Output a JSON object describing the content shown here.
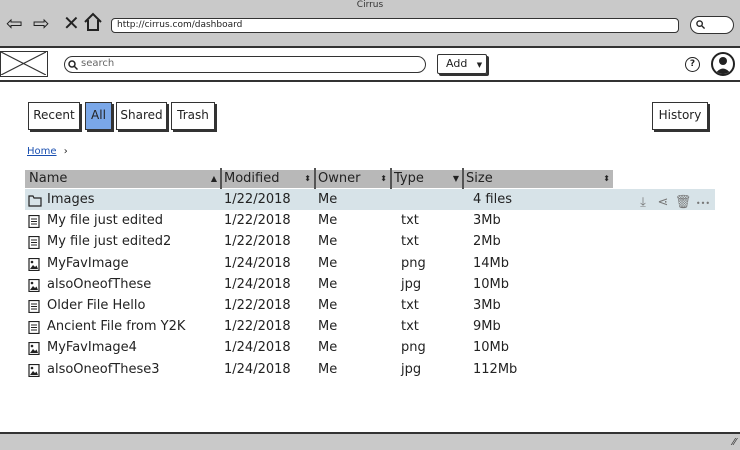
{
  "window": {
    "title": "Cirrus"
  },
  "browser": {
    "back_icon": "arrow-left-icon",
    "forward_icon": "arrow-right-icon",
    "stop_icon": "close-icon",
    "home_icon": "home-icon",
    "url": "http://cirrus.com/dashboard",
    "search_icon": "search-icon"
  },
  "appbar": {
    "search_placeholder": "search",
    "add_label": "Add",
    "help_icon": "help-icon",
    "avatar_icon": "user-avatar-icon"
  },
  "tabs": [
    {
      "label": "Recent",
      "active": false
    },
    {
      "label": "All",
      "active": true
    },
    {
      "label": "Shared",
      "active": false
    },
    {
      "label": "Trash",
      "active": false
    }
  ],
  "history_label": "History",
  "breadcrumb": {
    "home": "Home"
  },
  "table": {
    "columns": [
      "Name",
      "Modified",
      "Owner",
      "Type",
      "Size"
    ],
    "rows": [
      {
        "name": "Images",
        "modified": "1/22/2018",
        "owner": "Me",
        "type": "",
        "size": "4 files",
        "icon": "folder-icon",
        "selected": true
      },
      {
        "name": "My file just edited",
        "modified": "1/22/2018",
        "owner": "Me",
        "type": "txt",
        "size": "3Mb",
        "icon": "document-icon"
      },
      {
        "name": "My file just edited2",
        "modified": "1/22/2018",
        "owner": "Me",
        "type": "txt",
        "size": "2Mb",
        "icon": "document-icon"
      },
      {
        "name": "MyFavImage",
        "modified": "1/24/2018",
        "owner": "Me",
        "type": "png",
        "size": "14Mb",
        "icon": "image-file-icon"
      },
      {
        "name": "alsoOneofThese",
        "modified": "1/24/2018",
        "owner": "Me",
        "type": "jpg",
        "size": "10Mb",
        "icon": "image-file-icon"
      },
      {
        "name": "Older File Hello",
        "modified": "1/22/2018",
        "owner": "Me",
        "type": "txt",
        "size": "3Mb",
        "icon": "document-icon"
      },
      {
        "name": "Ancient File from Y2K",
        "modified": "1/22/2018",
        "owner": "Me",
        "type": "txt",
        "size": "9Mb",
        "icon": "document-icon"
      },
      {
        "name": "MyFavImage4",
        "modified": "1/24/2018",
        "owner": "Me",
        "type": "png",
        "size": "10Mb",
        "icon": "image-file-icon"
      },
      {
        "name": "alsoOneofThese3",
        "modified": "1/24/2018",
        "owner": "Me",
        "type": "jpg",
        "size": "112Mb",
        "icon": "image-file-icon"
      }
    ],
    "row_actions": [
      "download-icon",
      "share-icon",
      "trash-icon",
      "more-icon"
    ]
  }
}
